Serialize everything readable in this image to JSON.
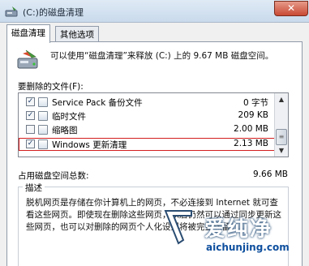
{
  "window": {
    "title": "(C:)的磁盘清理",
    "close_label": "✕"
  },
  "tabs": [
    {
      "label": "磁盘清理",
      "active": true
    },
    {
      "label": "其他选项",
      "active": false
    }
  ],
  "info": {
    "text": "可以使用“磁盘清理”来释放 (C:) 上的 9.67 MB 磁盘空间。"
  },
  "files": {
    "label": "要删除的文件(F):",
    "items": [
      {
        "name": "Service Pack 备份文件",
        "size": "0 字节",
        "checked": true
      },
      {
        "name": "临时文件",
        "size": "209 KB",
        "checked": true
      },
      {
        "name": "缩略图",
        "size": "2.00 MB",
        "checked": false
      },
      {
        "name": "Windows 更新清理",
        "size": "2.13 MB",
        "checked": true
      }
    ]
  },
  "total": {
    "label": "占用磁盘空间总数:",
    "value": "9.66 MB"
  },
  "description": {
    "title": "描述",
    "text": "脱机网页是存储在你计算机上的网页，不必连接到 Internet 就可查看这些网页。即使现在删除这些网页，以后仍然可以通过同步更新这些网页，也可以对删除的网页个人化设置将被完整保留。"
  },
  "watermark": {
    "brand": "爱纯净",
    "url": "aichunjing.com"
  }
}
